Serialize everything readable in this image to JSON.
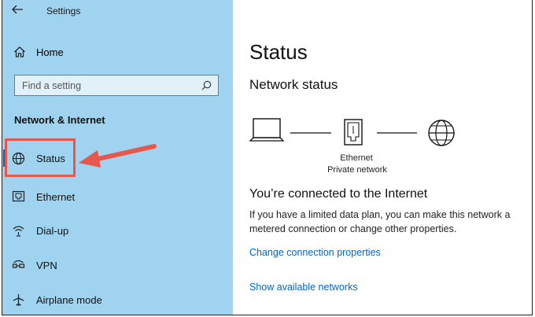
{
  "window": {
    "title": "Settings"
  },
  "sidebar": {
    "home_label": "Home",
    "search_placeholder": "Find a setting",
    "section_heading": "Network & Internet",
    "items": [
      {
        "label": "Status",
        "icon": "globe-network-icon",
        "selected": true
      },
      {
        "label": "Ethernet",
        "icon": "ethernet-icon",
        "selected": false
      },
      {
        "label": "Dial-up",
        "icon": "dialup-icon",
        "selected": false
      },
      {
        "label": "VPN",
        "icon": "vpn-icon",
        "selected": false
      },
      {
        "label": "Airplane mode",
        "icon": "airplane-icon",
        "selected": false
      }
    ]
  },
  "main": {
    "page_title": "Status",
    "section_title": "Network status",
    "diagram": {
      "adapter_name": "Ethernet",
      "network_name": "Private network"
    },
    "connected_title": "You’re connected to the Internet",
    "connected_description": "If you have a limited data plan, you can make this network a metered connection or change other properties.",
    "links": {
      "change_properties": "Change connection properties",
      "show_networks": "Show available networks"
    }
  },
  "colors": {
    "sidebar_bg": "#9fd3ef",
    "accent": "#0063b1",
    "link": "#0066cc",
    "annotation": "#e8574e"
  }
}
